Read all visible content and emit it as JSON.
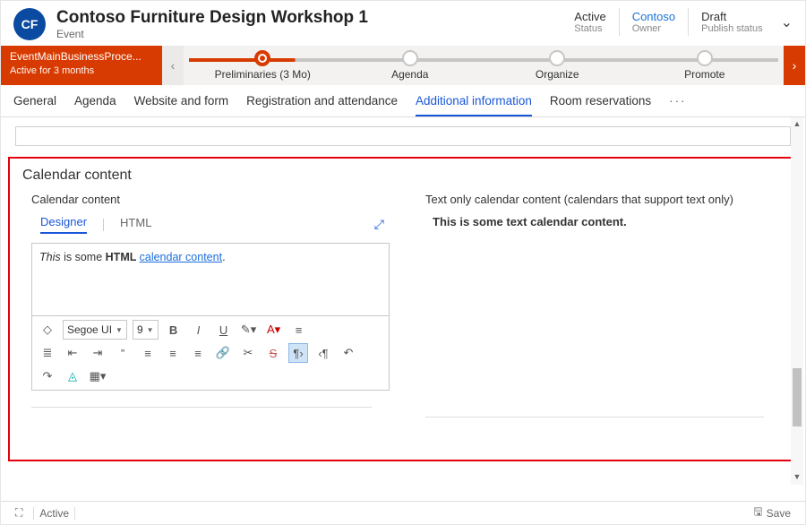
{
  "header": {
    "avatar": "CF",
    "title": "Contoso Furniture Design Workshop 1",
    "entity": "Event",
    "status": {
      "value": "Active",
      "label": "Status"
    },
    "owner": {
      "value": "Contoso",
      "label": "Owner"
    },
    "publish": {
      "value": "Draft",
      "label": "Publish status"
    }
  },
  "bpf": {
    "name": "EventMainBusinessProce...",
    "duration": "Active for 3 months",
    "stages": [
      "Preliminaries  (3 Mo)",
      "Agenda",
      "Organize",
      "Promote"
    ]
  },
  "tabs": [
    "General",
    "Agenda",
    "Website and form",
    "Registration and attendance",
    "Additional information",
    "Room reservations",
    "···"
  ],
  "section": {
    "title": "Calendar content",
    "left_label": "Calendar content",
    "right_label": "Text only calendar content (calendars that support text only)",
    "subtabs": [
      "Designer",
      "HTML"
    ],
    "html_parts": [
      "This",
      " is some ",
      "HTML ",
      "calendar content",
      "."
    ],
    "text_content": "This is some text calendar content."
  },
  "toolbar": {
    "font": "Segoe UI",
    "size": "9"
  },
  "footer": {
    "status": "Active",
    "save": "Save"
  }
}
